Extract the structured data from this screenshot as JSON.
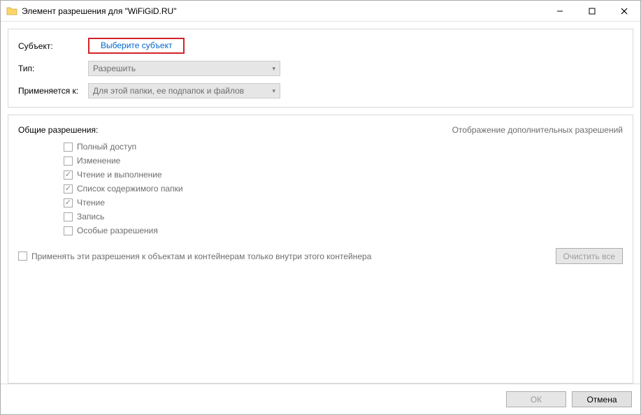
{
  "window": {
    "title": "Элемент разрешения для \"WiFiGiD.RU\""
  },
  "form": {
    "subject_label": "Субъект:",
    "subject_link": "Выберите субъект",
    "type_label": "Тип:",
    "type_value": "Разрешить",
    "applies_label": "Применяется к:",
    "applies_value": "Для этой папки, ее подпапок и файлов"
  },
  "permissions": {
    "heading": "Общие разрешения:",
    "advanced_link": "Отображение дополнительных разрешений",
    "items": [
      {
        "label": "Полный доступ",
        "checked": false
      },
      {
        "label": "Изменение",
        "checked": false
      },
      {
        "label": "Чтение и выполнение",
        "checked": true
      },
      {
        "label": "Список содержимого папки",
        "checked": true
      },
      {
        "label": "Чтение",
        "checked": true
      },
      {
        "label": "Запись",
        "checked": false
      },
      {
        "label": "Особые разрешения",
        "checked": false
      }
    ],
    "apply_only": "Применять эти разрешения к объектам и контейнерам только внутри этого контейнера",
    "clear_all": "Очистить все"
  },
  "buttons": {
    "ok": "ОК",
    "cancel": "Отмена"
  }
}
